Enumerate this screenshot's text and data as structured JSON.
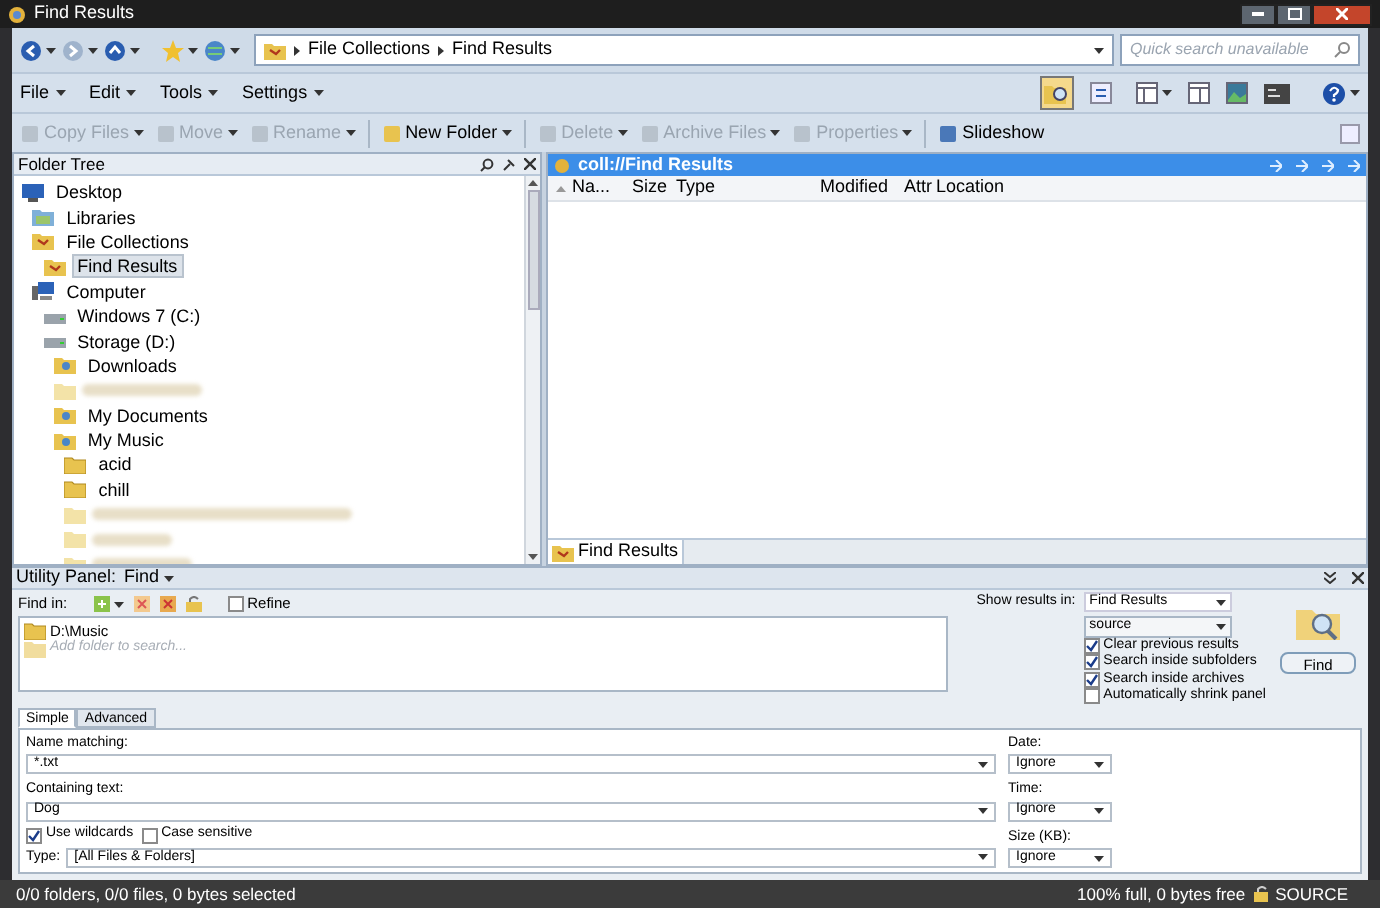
{
  "window": {
    "title": "Find Results"
  },
  "address_bar": {
    "path": [
      "File Collections",
      "Find Results"
    ],
    "search_placeholder": "Quick search unavailable"
  },
  "menu": [
    "File",
    "Edit",
    "Tools",
    "Settings"
  ],
  "toolbar": [
    {
      "label": "Copy Files",
      "disabled": true,
      "dropdown": true
    },
    {
      "label": "Move",
      "disabled": true,
      "dropdown": true
    },
    {
      "label": "Rename",
      "disabled": true,
      "dropdown": true
    },
    {
      "label": "New Folder",
      "disabled": false,
      "dropdown": true
    },
    {
      "label": "Delete",
      "disabled": true,
      "dropdown": true
    },
    {
      "label": "Archive Files",
      "disabled": true,
      "dropdown": true
    },
    {
      "label": "Properties",
      "disabled": true,
      "dropdown": true
    },
    {
      "label": "Slideshow",
      "disabled": false,
      "dropdown": false
    }
  ],
  "folder_tree": {
    "title": "Folder Tree",
    "items": [
      {
        "label": "Desktop",
        "kind": "desktop",
        "selected": false,
        "children": [
          {
            "label": "Libraries",
            "kind": "library",
            "selected": false
          },
          {
            "label": "File Collections",
            "kind": "collection",
            "selected": false,
            "children": [
              {
                "label": "Find Results",
                "kind": "collection",
                "selected": true
              }
            ]
          },
          {
            "label": "Computer",
            "kind": "computer",
            "selected": false,
            "children": [
              {
                "label": "Windows 7 (C:)",
                "kind": "drive",
                "selected": false
              },
              {
                "label": "Storage (D:)",
                "kind": "drive",
                "selected": false,
                "children": [
                  {
                    "label": "Downloads",
                    "kind": "special",
                    "selected": false
                  },
                  {
                    "kind": "blurred"
                  },
                  {
                    "label": "My Documents",
                    "kind": "special",
                    "selected": false
                  },
                  {
                    "label": "My Music",
                    "kind": "special",
                    "selected": false,
                    "children": [
                      {
                        "label": "acid",
                        "kind": "folder",
                        "selected": false
                      },
                      {
                        "label": "chill",
                        "kind": "folder",
                        "selected": false
                      },
                      {
                        "kind": "blurred"
                      },
                      {
                        "kind": "blurred"
                      },
                      {
                        "kind": "blurred"
                      }
                    ]
                  }
                ]
              }
            ]
          }
        ]
      }
    ]
  },
  "file_list": {
    "title": "coll://Find Results",
    "columns": [
      "Na...",
      "Size",
      "Type",
      "Modified",
      "Attr",
      "Location"
    ],
    "tab": "Find Results"
  },
  "utility_panel": {
    "title": "Utility Panel:",
    "mode": "Find",
    "find_in_label": "Find in:",
    "refine": {
      "label": "Refine",
      "checked": false
    },
    "folders": [
      {
        "label": "D:\\Music",
        "kind": "folder"
      },
      {
        "label": "Add folder to search...",
        "kind": "hint"
      }
    ],
    "show_results_label": "Show results in:",
    "show_results": "Find Results",
    "source": "source",
    "options": [
      {
        "label": "Clear previous results",
        "checked": true
      },
      {
        "label": "Search inside subfolders",
        "checked": true
      },
      {
        "label": "Search inside archives",
        "checked": true
      },
      {
        "label": "Automatically shrink panel",
        "checked": false
      }
    ],
    "find_button": "Find",
    "tabs": [
      {
        "label": "Simple",
        "selected": true
      },
      {
        "label": "Advanced",
        "selected": false
      }
    ],
    "name_label": "Name matching:",
    "name_value": "*.txt",
    "text_label": "Containing text:",
    "text_value": "Dog",
    "wildcards": {
      "label": "Use wildcards",
      "checked": true
    },
    "case": {
      "label": "Case sensitive",
      "checked": false
    },
    "type_label": "Type:",
    "type_value": "[All Files & Folders]",
    "filters": [
      {
        "label": "Date:",
        "value": "Ignore"
      },
      {
        "label": "Time:",
        "value": "Ignore"
      },
      {
        "label": "Size (KB):",
        "value": "Ignore"
      }
    ]
  },
  "status_bar": {
    "selection": "0/0 folders, 0/0 files, 0 bytes selected",
    "space": "100% full, 0 bytes free",
    "drive": "SOURCE"
  }
}
